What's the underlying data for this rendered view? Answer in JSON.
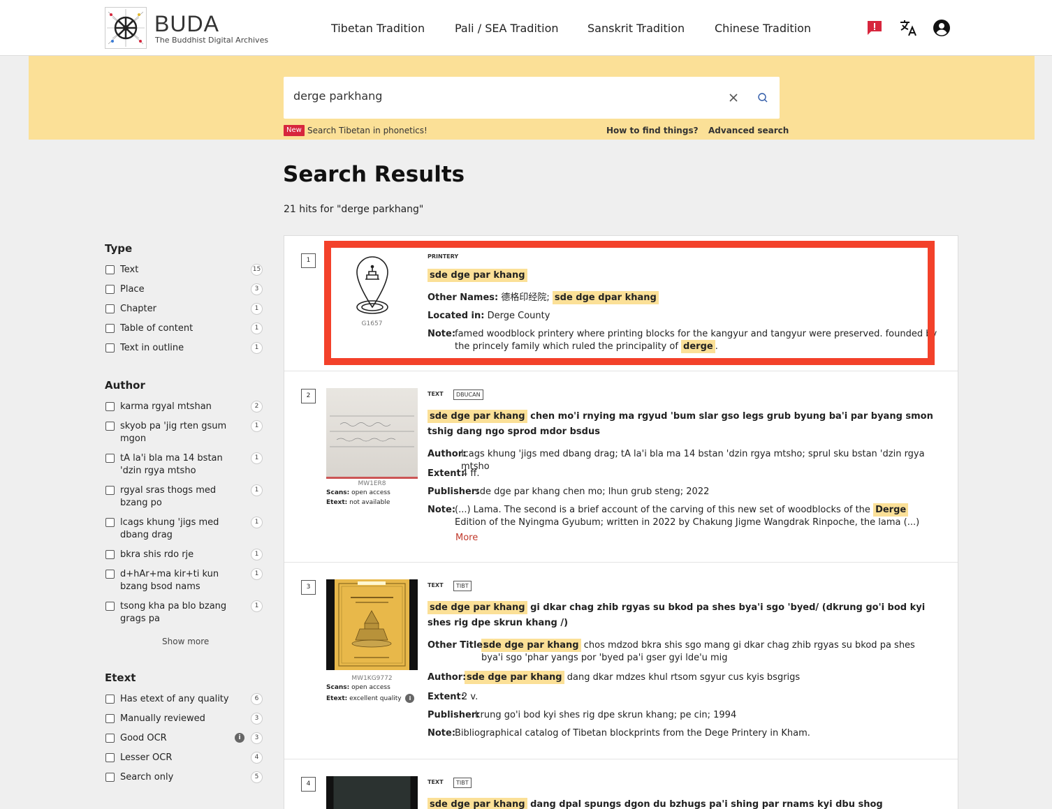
{
  "header": {
    "logo_title": "BUDA",
    "logo_subtitle": "The Buddhist Digital Archives",
    "nav": [
      "Tibetan Tradition",
      "Pali / SEA Tradition",
      "Sanskrit Tradition",
      "Chinese Tradition"
    ],
    "icons": [
      "report-icon",
      "translate-icon",
      "account-icon"
    ],
    "report_color": "#d7263d"
  },
  "search": {
    "value": "derge parkhang",
    "new_badge": "New",
    "phonetics_link": "Search Tibetan in phonetics!",
    "help_link": "How to find things?",
    "advanced_link": "Advanced search"
  },
  "page": {
    "title": "Search Results",
    "hits": "21 hits for \"derge parkhang\""
  },
  "facets": {
    "type": {
      "heading": "Type",
      "items": [
        {
          "label": "Text",
          "count": "15"
        },
        {
          "label": "Place",
          "count": "3"
        },
        {
          "label": "Chapter",
          "count": "1"
        },
        {
          "label": "Table of content",
          "count": "1"
        },
        {
          "label": "Text in outline",
          "count": "1"
        }
      ]
    },
    "author": {
      "heading": "Author",
      "items": [
        {
          "label": "karma rgyal mtshan",
          "count": "2"
        },
        {
          "label": "skyob pa 'jig rten gsum mgon",
          "count": "1"
        },
        {
          "label": "tA la'i bla ma 14 bstan 'dzin rgya mtsho",
          "count": "1"
        },
        {
          "label": "rgyal sras thogs med bzang po",
          "count": "1"
        },
        {
          "label": "lcags khung 'jigs med dbang drag",
          "count": "1"
        },
        {
          "label": "bkra shis rdo rje",
          "count": "1"
        },
        {
          "label": "d+hAr+ma kir+ti kun bzang bsod nams",
          "count": "1"
        },
        {
          "label": "tsong kha pa blo bzang grags pa",
          "count": "1"
        }
      ],
      "show_more": "Show more"
    },
    "etext": {
      "heading": "Etext",
      "items": [
        {
          "label": "Has etext of any quality",
          "count": "6"
        },
        {
          "label": "Manually reviewed",
          "count": "3"
        },
        {
          "label": "Good OCR",
          "count": "3"
        },
        {
          "label": "Lesser OCR",
          "count": "4"
        },
        {
          "label": "Search only",
          "count": "5"
        }
      ]
    }
  },
  "results": [
    {
      "num": "1",
      "type": "PRINTERY",
      "id": "G1657",
      "title_hl": "sde dge par khang",
      "other_names_label": "Other Names:",
      "other_names_plain": "德格印经院;",
      "other_names_hl": "sde dge dpar khang",
      "located_label": "Located in:",
      "located": "Derge County",
      "note_label": "Note:",
      "note": "famed woodblock printery where printing blocks for the kangyur and tangyur were preserved. founded by the princely family which ruled the principality of",
      "note_hl": "derge",
      "note_end": "."
    },
    {
      "num": "2",
      "type": "TEXT",
      "tag": "DBUCAN",
      "id": "MW1ER8",
      "scans_label": "Scans:",
      "scans": "open access",
      "etext_label": "Etext:",
      "etext": "not available",
      "title_hl": "sde dge par khang",
      "title_rest": "chen mo'i rnying ma rgyud 'bum slar gso legs grub byung ba'i par byang smon tshig dang ngo sprod mdor bsdus",
      "author_label": "Author:",
      "author": "lcags khung 'jigs med dbang drag; tA la'i bla ma 14 bstan 'dzin rgya mtsho; sprul sku bstan 'dzin rgya mtsho",
      "extent_label": "Extent:",
      "extent": "4 ff.",
      "publisher_label": "Publisher:",
      "publisher": "sde dge par khang chen mo; lhun grub steng; 2022",
      "note_label": "Note:",
      "note_a": "(...) Lama. The second is a brief account of the carving of this new set of woodblocks of the",
      "note_hl": "Derge",
      "note_b": "Edition of the Nyingma Gyubum; written in 2022 by Chakung Jigme Wangdrak Rinpoche, the lama (...)",
      "more": "More"
    },
    {
      "num": "3",
      "type": "TEXT",
      "tag": "TIBT",
      "id": "MW1KG9772",
      "scans_label": "Scans:",
      "scans": "open access",
      "etext_label": "Etext:",
      "etext": "excellent quality",
      "title_hl": "sde dge par khang",
      "title_rest": "gi dkar chag zhib rgyas su bkod pa shes bya'i sgo 'byed/ (dkrung go'i bod kyi shes rig dpe skrun khang /)",
      "other_title_label": "Other Title:",
      "other_title_hl": "sde dge par khang",
      "other_title_rest": "chos mdzod bkra shis sgo mang gi dkar chag zhib rgyas su bkod pa shes bya'i sgo 'phar yangs por 'byed pa'i gser gyi lde'u mig",
      "author_label": "Author:",
      "author_hl": "sde dge par khang",
      "author_rest": "dang dkar mdzes khul rtsom sgyur cus kyis bsgrigs",
      "extent_label": "Extent:",
      "extent": "2 v.",
      "publisher_label": "Publisher:",
      "publisher": "krung go'i bod kyi shes rig dpe skrun khang; pe cin; 1994",
      "note_label": "Note:",
      "note": "Bibliographical catalog of Tibetan blockprints from the Dege Printery in Kham."
    },
    {
      "num": "4",
      "type": "TEXT",
      "tag": "TIBT",
      "title_hl": "sde dge par khang",
      "title_rest": "dang dpal spungs dgon du bzhugs pa'i shing par rnams kyi dbu shog"
    }
  ]
}
